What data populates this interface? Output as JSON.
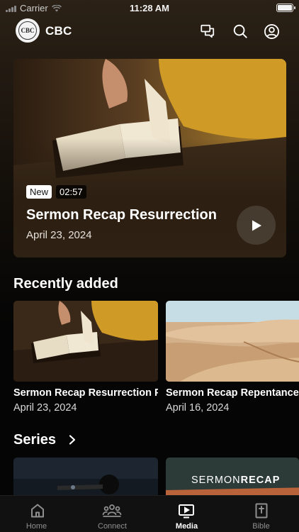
{
  "status_bar": {
    "carrier": "Carrier",
    "time": "11:28 AM",
    "battery_level": 1.0
  },
  "header": {
    "logo_text": "CBC",
    "brand": "CBC",
    "icons": [
      "chat-icon",
      "search-icon",
      "profile-icon"
    ]
  },
  "hero": {
    "badge_new": "New",
    "duration": "02:57",
    "title": "Sermon Recap Resurrection",
    "date": "April 23, 2024"
  },
  "recently_added": {
    "title": "Recently added",
    "items": [
      {
        "title": "Sermon Recap Resurrection Pa",
        "date": "April 23, 2024"
      },
      {
        "title": "Sermon Recap Repentance",
        "date": "April 16, 2024"
      }
    ]
  },
  "series": {
    "title": "Series",
    "items": [
      {
        "overlay": ""
      },
      {
        "overlay_light": "SERMON",
        "overlay_bold": "RECAP"
      }
    ]
  },
  "tab_bar": {
    "active": "media",
    "tabs": [
      {
        "id": "home",
        "label": "Home"
      },
      {
        "id": "connect",
        "label": "Connect"
      },
      {
        "id": "media",
        "label": "Media"
      },
      {
        "id": "bible",
        "label": "Bible"
      }
    ]
  },
  "colors": {
    "background": "#050505",
    "tab_bar": "#111111",
    "accent": "#ffffff",
    "muted": "#8f8f8f"
  }
}
